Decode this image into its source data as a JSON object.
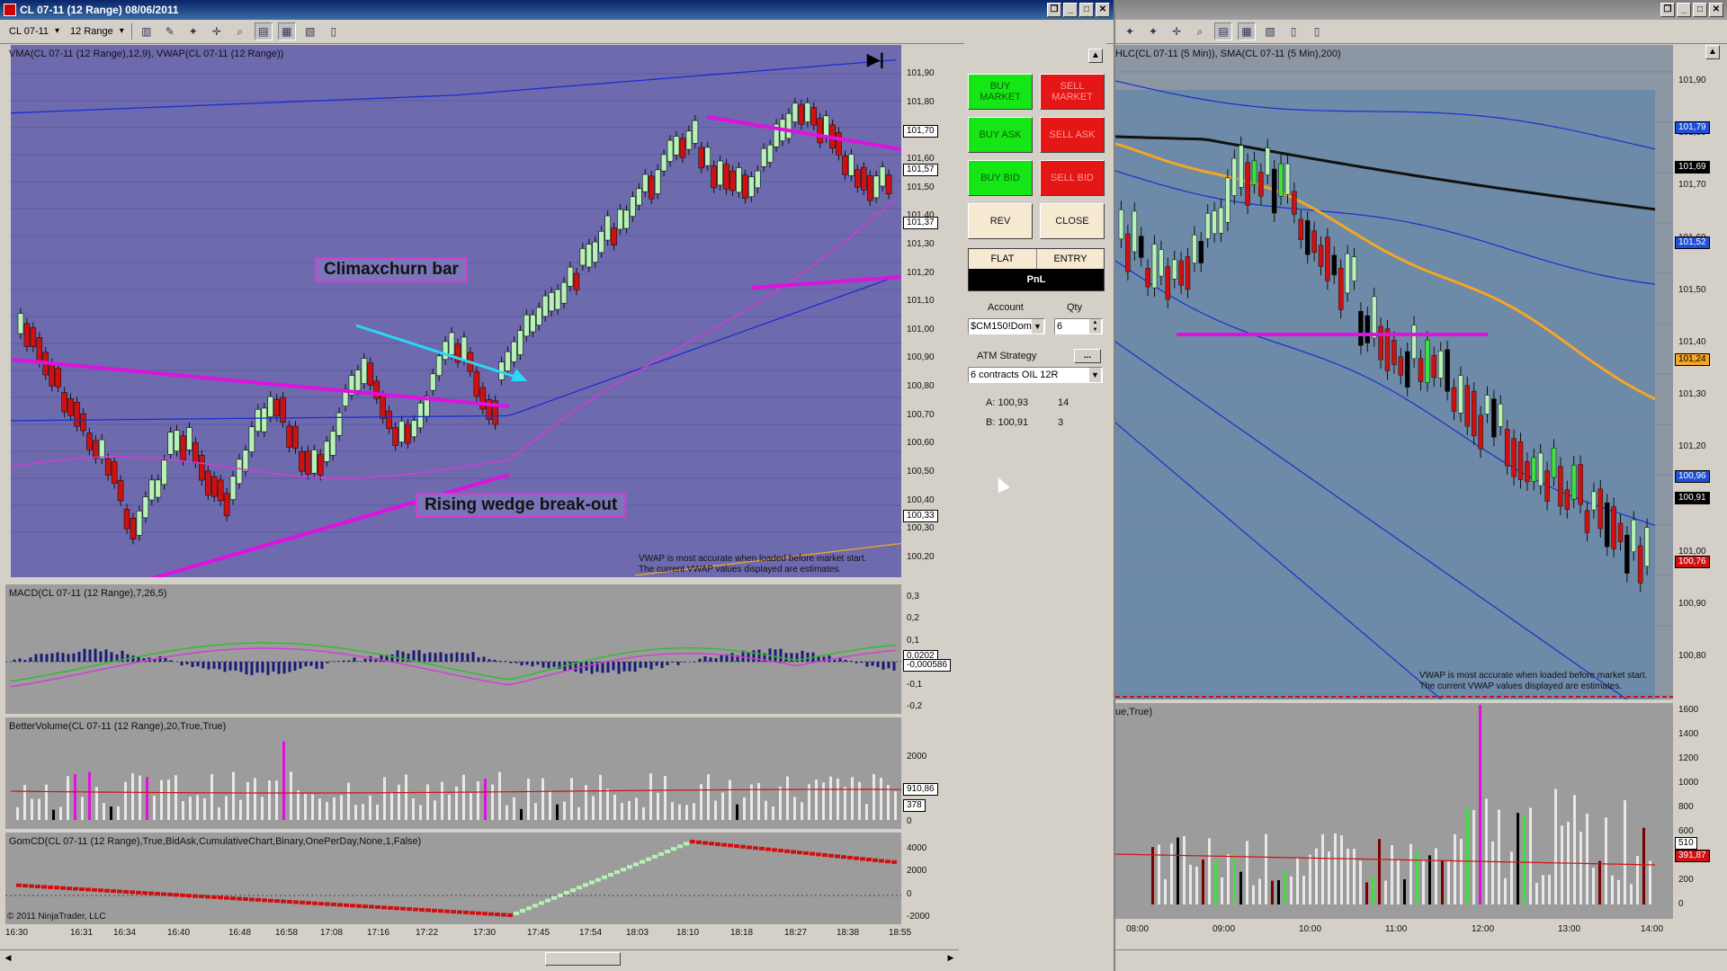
{
  "left_window": {
    "title": "CL 07-11 (12 Range)  08/06/2011",
    "instrument": "CL 07-11",
    "period": "12 Range",
    "main_label": "VMA(CL 07-11 (12 Range),12,9), VWAP(CL 07-11 (12 Range))",
    "price_ticks": [
      "101,90",
      "101,80",
      "101,70",
      "101,60",
      "101,50",
      "101,40",
      "101,30",
      "101,20",
      "101,10",
      "101,00",
      "100,90",
      "100,80",
      "100,70",
      "100,60",
      "100,50",
      "100,40",
      "100,30",
      "100,20"
    ],
    "price_tags": [
      {
        "text": "101,70",
        "bg": "#ffffff",
        "fg": "#000000"
      },
      {
        "text": "101,57",
        "bg": "#ffffff",
        "fg": "#000000"
      },
      {
        "text": "101,37",
        "bg": "#ffffff",
        "fg": "#000000"
      },
      {
        "text": "100,33",
        "bg": "#ffffff",
        "fg": "#000000"
      }
    ],
    "annotation_climax": "Climaxchurn bar",
    "annotation_wedge": "Rising wedge break-out",
    "vwap_note_1": "VWAP is most accurate when loaded before market start.",
    "vwap_note_2": "The current VWAP values displayed are estimates.",
    "macd_label": "MACD(CL 07-11 (12 Range),7,26,5)",
    "macd_ticks": [
      "0,3",
      "0,2",
      "0,1",
      "0",
      "-0,1",
      "-0,2"
    ],
    "macd_tags": [
      "0,0202",
      "-0,000586"
    ],
    "bv_label": "BetterVolume(CL 07-11 (12 Range),20,True,True)",
    "bv_ticks": [
      "2000",
      "1000",
      "0"
    ],
    "bv_tags": [
      "910,86",
      "378"
    ],
    "gom_label": "GomCD(CL 07-11 (12 Range),True,BidAsk,CumulativeChart,Binary,OnePerDay,None,1,False)",
    "gom_ticks": [
      "4000",
      "2000",
      "0",
      "-2000"
    ],
    "copyright": "© 2011 NinjaTrader, LLC",
    "time_ticks": [
      "16:30",
      "16:31",
      "16:34",
      "16:40",
      "16:48",
      "16:58",
      "17:08",
      "17:16",
      "17:22",
      "17:30",
      "17:45",
      "17:54",
      "18:03",
      "18:10",
      "18:18",
      "18:27",
      "18:38",
      "18:55"
    ]
  },
  "order_panel": {
    "buy_market": "BUY MARKET",
    "sell_market": "SELL MARKET",
    "buy_ask": "BUY ASK",
    "sell_ask": "SELL ASK",
    "buy_bid": "BUY BID",
    "sell_bid": "SELL BID",
    "rev": "REV",
    "close": "CLOSE",
    "flat": "FLAT",
    "entry": "ENTRY",
    "pnl": "PnL",
    "account_label": "Account",
    "qty_label": "Qty",
    "account_value": "$CM150!Dom",
    "qty_value": "6",
    "atm_label": "ATM Strategy",
    "atm_more": "...",
    "atm_value": "6 contracts OIL 12R",
    "ask_label": "A: 100,93",
    "ask_size": "14",
    "bid_label": "B: 100,91",
    "bid_size": "3"
  },
  "right_window": {
    "main_label": "HLC(CL 07-11 (5 Min)), SMA(CL 07-11 (5 Min),200)",
    "price_ticks": [
      "101,90",
      "101,80",
      "101,70",
      "101,60",
      "101,50",
      "101,40",
      "101,30",
      "101,20",
      "101,10",
      "101,00",
      "100,90",
      "100,80"
    ],
    "price_tags": [
      {
        "text": "101,79",
        "bg": "#1f4fd8",
        "fg": "#ffffff"
      },
      {
        "text": "101,69",
        "bg": "#000000",
        "fg": "#ffffff"
      },
      {
        "text": "101,52",
        "bg": "#1f4fd8",
        "fg": "#ffffff"
      },
      {
        "text": "101,24",
        "bg": "#f5a623",
        "fg": "#000000"
      },
      {
        "text": "100,96",
        "bg": "#1f4fd8",
        "fg": "#ffffff"
      },
      {
        "text": "100,91",
        "bg": "#000000",
        "fg": "#ffffff"
      },
      {
        "text": "100,76",
        "bg": "#d01010",
        "fg": "#ffffff"
      }
    ],
    "vwap_note_1": "VWAP is most accurate when loaded before market start.",
    "vwap_note_2": "The current VWAP values displayed are estimates.",
    "vol_label": "ue,True)",
    "vol_ticks": [
      "1600",
      "1400",
      "1200",
      "1000",
      "800",
      "600",
      "400",
      "200",
      "0"
    ],
    "vol_tags": [
      {
        "text": "510",
        "bg": "#ffffff",
        "fg": "#000000"
      },
      {
        "text": "391,87",
        "bg": "#d01010",
        "fg": "#ffffff"
      }
    ],
    "time_ticks": [
      "08:00",
      "09:00",
      "10:00",
      "11:00",
      "12:00",
      "13:00",
      "14:00"
    ]
  },
  "colors": {
    "left_chart_bg": "#6e6aae",
    "right_chart_bg": "#6d8aa8",
    "up": "#b6f2b6",
    "down": "#d01010",
    "magenta": "#e010e0",
    "cyan": "#29d9f5",
    "vwap": "#1a2fd0",
    "orange": "#f5a623"
  }
}
